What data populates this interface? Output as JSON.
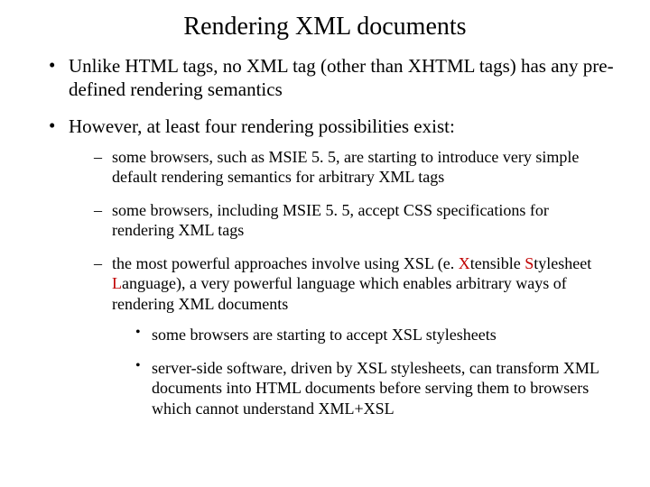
{
  "title": "Rendering XML documents",
  "bullets": {
    "b1": "Unlike HTML tags, no XML tag (other than XHTML tags) has any pre-defined rendering semantics",
    "b2": "However, at least four rendering possibilities exist:",
    "sub": {
      "s1": "some browsers, such as MSIE 5. 5, are starting to introduce very simple default rendering semantics for arbitrary XML tags",
      "s2": "some browsers, including MSIE 5. 5, accept CSS specifications for rendering XML tags",
      "s3_pre": "the most powerful approaches involve using XSL (e. ",
      "s3_x": "X",
      "s3_mid1": "tensible ",
      "s3_s": "S",
      "s3_mid2": "tylesheet ",
      "s3_l": "L",
      "s3_post": "anguage), a very powerful language which enables arbitrary ways of rendering XML documents",
      "ss1": "some browsers are starting to accept XSL stylesheets",
      "ss2": "server-side software, driven by XSL stylesheets, can transform XML documents into HTML documents before serving them to browsers which cannot understand XML+XSL"
    }
  }
}
